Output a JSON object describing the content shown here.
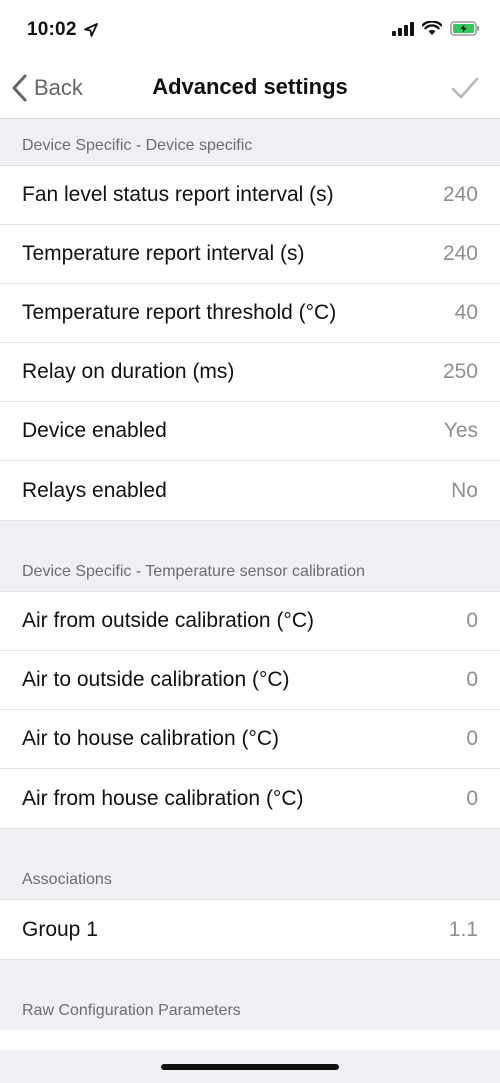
{
  "status_bar": {
    "time": "10:02",
    "icons": [
      "location-arrow-icon",
      "cellular-signal-icon",
      "wifi-icon",
      "battery-charging-icon"
    ]
  },
  "navbar": {
    "back_label": "Back",
    "title": "Advanced settings",
    "accent": "#6a6a6a"
  },
  "sections": [
    {
      "header": "Device Specific - Device specific",
      "rows": [
        {
          "label": "Fan level status report interval (s)",
          "value": "240"
        },
        {
          "label": "Temperature report interval (s)",
          "value": "240"
        },
        {
          "label": "Temperature report threshold (°C)",
          "value": "40"
        },
        {
          "label": "Relay on duration (ms)",
          "value": "250"
        },
        {
          "label": "Device enabled",
          "value": "Yes"
        },
        {
          "label": "Relays enabled",
          "value": "No"
        }
      ]
    },
    {
      "header": "Device Specific - Temperature sensor calibration",
      "rows": [
        {
          "label": "Air from outside calibration (°C)",
          "value": "0"
        },
        {
          "label": "Air to outside calibration (°C)",
          "value": "0"
        },
        {
          "label": "Air to house calibration (°C)",
          "value": "0"
        },
        {
          "label": "Air from house calibration (°C)",
          "value": "0"
        }
      ]
    },
    {
      "header": "Associations",
      "rows": [
        {
          "label": "Group 1",
          "value": "1.1"
        }
      ]
    },
    {
      "header": "Raw Configuration Parameters",
      "rows": []
    }
  ]
}
